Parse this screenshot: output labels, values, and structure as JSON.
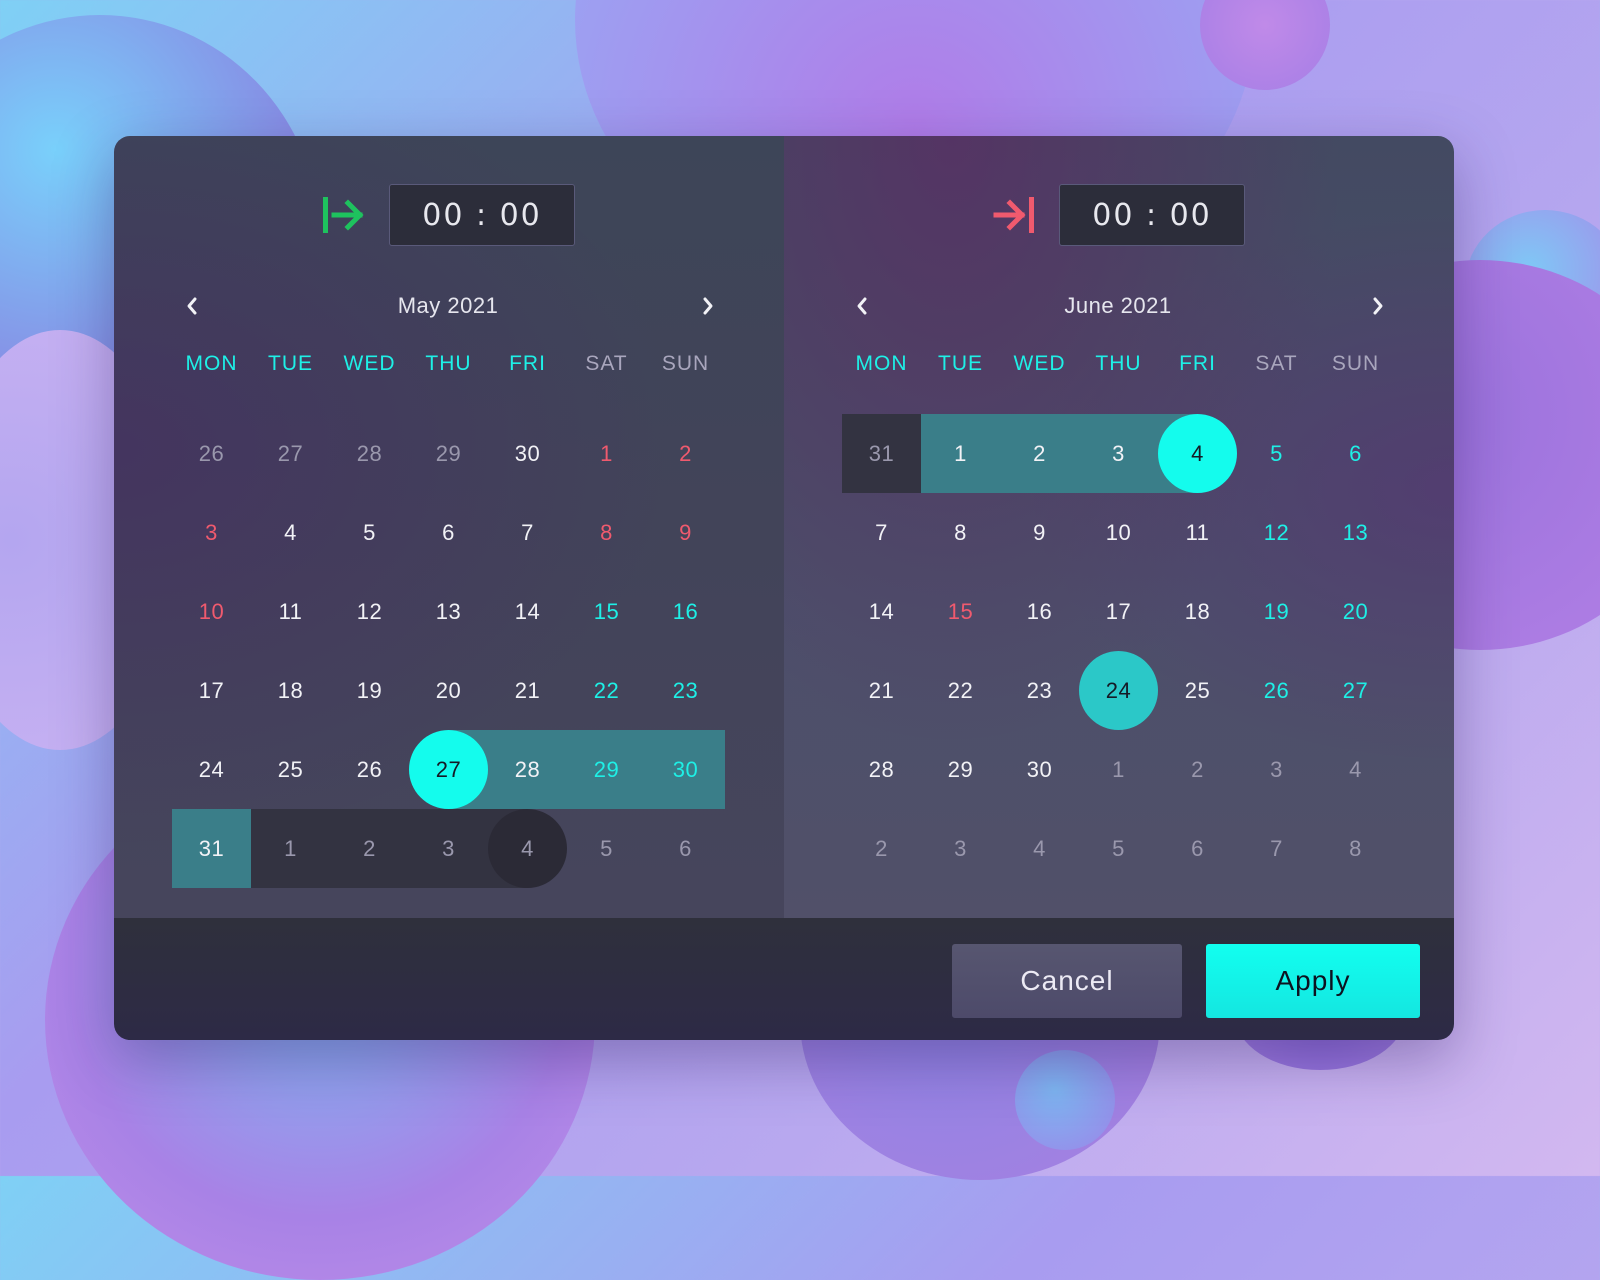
{
  "start": {
    "icon": "range-start-arrow-icon",
    "icon_color": "#1ec25e",
    "time_value": "00 : 00",
    "month_title": "May 2021",
    "prev_icon": "chevron-left-icon",
    "next_icon": "chevron-right-icon",
    "weekdays": [
      "MON",
      "TUE",
      "WED",
      "THU",
      "FRI",
      "SAT",
      "SUN"
    ],
    "weeks": [
      [
        {
          "d": "26",
          "c": "dim"
        },
        {
          "d": "27",
          "c": "dim"
        },
        {
          "d": "28",
          "c": "dim"
        },
        {
          "d": "29",
          "c": "dim"
        },
        {
          "d": "30",
          "c": "norm"
        },
        {
          "d": "1",
          "c": "red"
        },
        {
          "d": "2",
          "c": "red"
        }
      ],
      [
        {
          "d": "3",
          "c": "red"
        },
        {
          "d": "4",
          "c": "norm"
        },
        {
          "d": "5",
          "c": "norm"
        },
        {
          "d": "6",
          "c": "norm"
        },
        {
          "d": "7",
          "c": "norm"
        },
        {
          "d": "8",
          "c": "red"
        },
        {
          "d": "9",
          "c": "red"
        }
      ],
      [
        {
          "d": "10",
          "c": "red"
        },
        {
          "d": "11",
          "c": "norm"
        },
        {
          "d": "12",
          "c": "norm"
        },
        {
          "d": "13",
          "c": "norm"
        },
        {
          "d": "14",
          "c": "norm"
        },
        {
          "d": "15",
          "c": "cyan"
        },
        {
          "d": "16",
          "c": "cyan"
        }
      ],
      [
        {
          "d": "17",
          "c": "norm"
        },
        {
          "d": "18",
          "c": "norm"
        },
        {
          "d": "19",
          "c": "norm"
        },
        {
          "d": "20",
          "c": "norm"
        },
        {
          "d": "21",
          "c": "norm"
        },
        {
          "d": "22",
          "c": "cyan"
        },
        {
          "d": "23",
          "c": "cyan"
        }
      ],
      [
        {
          "d": "24",
          "c": "norm"
        },
        {
          "d": "25",
          "c": "norm"
        },
        {
          "d": "26",
          "c": "norm"
        },
        {
          "d": "27",
          "c": "dark",
          "s": "start"
        },
        {
          "d": "28",
          "c": "norm",
          "s": "range"
        },
        {
          "d": "29",
          "c": "cyan",
          "s": "range"
        },
        {
          "d": "30",
          "c": "cyan",
          "s": "range"
        }
      ],
      [
        {
          "d": "31",
          "c": "norm",
          "s": "range"
        },
        {
          "d": "1",
          "c": "dim",
          "s": "ghost"
        },
        {
          "d": "2",
          "c": "dim",
          "s": "ghost"
        },
        {
          "d": "3",
          "c": "dim",
          "s": "ghost"
        },
        {
          "d": "4",
          "c": "dim",
          "s": "ghost-end"
        },
        {
          "d": "5",
          "c": "dim"
        },
        {
          "d": "6",
          "c": "dim"
        }
      ]
    ]
  },
  "end": {
    "icon": "range-end-arrow-icon",
    "icon_color": "#f05a6e",
    "time_value": "00 : 00",
    "month_title": "June 2021",
    "prev_icon": "chevron-left-icon",
    "next_icon": "chevron-right-icon",
    "weekdays": [
      "MON",
      "TUE",
      "WED",
      "THU",
      "FRI",
      "SAT",
      "SUN"
    ],
    "weeks": [
      [
        {
          "d": "31",
          "c": "dim",
          "s": "ghost"
        },
        {
          "d": "1",
          "c": "norm",
          "s": "range"
        },
        {
          "d": "2",
          "c": "norm",
          "s": "range"
        },
        {
          "d": "3",
          "c": "norm",
          "s": "range"
        },
        {
          "d": "4",
          "c": "dark",
          "s": "end"
        },
        {
          "d": "5",
          "c": "cyan"
        },
        {
          "d": "6",
          "c": "cyan"
        }
      ],
      [
        {
          "d": "7",
          "c": "norm"
        },
        {
          "d": "8",
          "c": "norm"
        },
        {
          "d": "9",
          "c": "norm"
        },
        {
          "d": "10",
          "c": "norm"
        },
        {
          "d": "11",
          "c": "norm"
        },
        {
          "d": "12",
          "c": "cyan"
        },
        {
          "d": "13",
          "c": "cyan"
        }
      ],
      [
        {
          "d": "14",
          "c": "norm"
        },
        {
          "d": "15",
          "c": "red"
        },
        {
          "d": "16",
          "c": "norm"
        },
        {
          "d": "17",
          "c": "norm"
        },
        {
          "d": "18",
          "c": "norm"
        },
        {
          "d": "19",
          "c": "cyan"
        },
        {
          "d": "20",
          "c": "cyan"
        }
      ],
      [
        {
          "d": "21",
          "c": "norm"
        },
        {
          "d": "22",
          "c": "norm"
        },
        {
          "d": "23",
          "c": "norm"
        },
        {
          "d": "24",
          "c": "dark",
          "s": "today"
        },
        {
          "d": "25",
          "c": "norm"
        },
        {
          "d": "26",
          "c": "cyan"
        },
        {
          "d": "27",
          "c": "cyan"
        }
      ],
      [
        {
          "d": "28",
          "c": "norm"
        },
        {
          "d": "29",
          "c": "norm"
        },
        {
          "d": "30",
          "c": "norm"
        },
        {
          "d": "1",
          "c": "dim"
        },
        {
          "d": "2",
          "c": "dim"
        },
        {
          "d": "3",
          "c": "dim"
        },
        {
          "d": "4",
          "c": "dim"
        }
      ],
      [
        {
          "d": "2",
          "c": "dim"
        },
        {
          "d": "3",
          "c": "dim"
        },
        {
          "d": "4",
          "c": "dim"
        },
        {
          "d": "5",
          "c": "dim"
        },
        {
          "d": "6",
          "c": "dim"
        },
        {
          "d": "7",
          "c": "dim"
        },
        {
          "d": "8",
          "c": "dim"
        }
      ]
    ]
  },
  "footer": {
    "cancel_label": "Cancel",
    "apply_label": "Apply"
  },
  "colors": {
    "accent": "#14fced",
    "range": "#3a7e89",
    "weekend_red": "#f05a6e",
    "today": "#2bc8c8"
  }
}
